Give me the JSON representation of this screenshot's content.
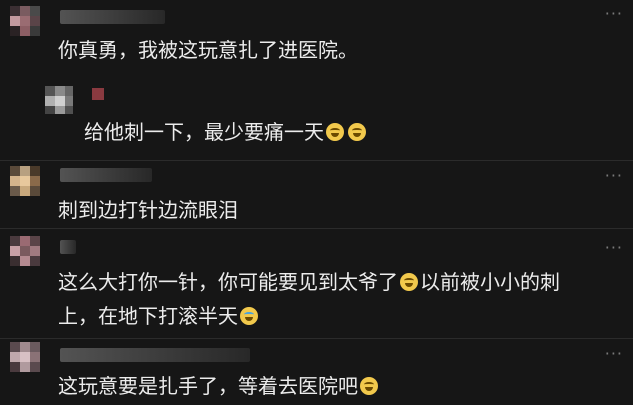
{
  "comments": [
    {
      "text": "你真勇，我被这玩意扎了进医院。",
      "emojis": [],
      "more": "···"
    },
    {
      "text": "给他刺一下，最少要痛一天",
      "emojis": [
        "rofl-emoji",
        "rofl-emoji"
      ],
      "more": ""
    },
    {
      "text": "刺到边打针边流眼泪",
      "emojis": [],
      "more": "···"
    },
    {
      "line1": "这么大打你一针，你可能要见到太爷了",
      "line1_tail": "以前被小小的刺",
      "line2": "上，在地下打滚半天",
      "emojis": [
        "rofl-emoji",
        "grimace-tear-emoji"
      ],
      "more": "···"
    },
    {
      "text": "这玩意要是扎手了，等着去医院吧",
      "emojis": [
        "grin-sweat-emoji"
      ],
      "more": "···"
    }
  ],
  "colors": {
    "background": "#161616",
    "text": "#ececec",
    "muted": "#7a7a7a",
    "divider": "#2b2b2b"
  }
}
